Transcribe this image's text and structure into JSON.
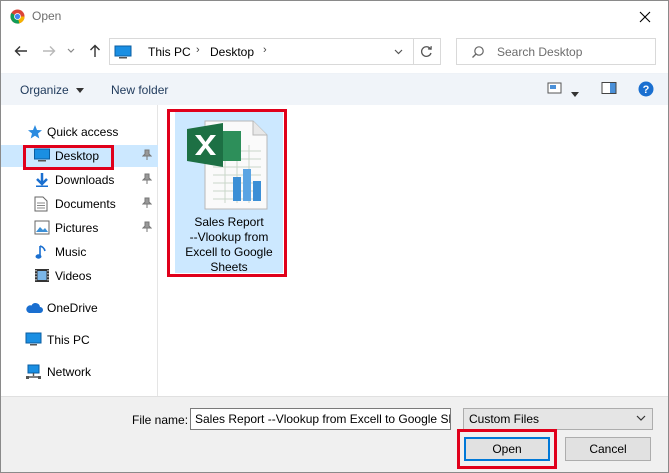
{
  "window": {
    "title": "Open"
  },
  "address": {
    "crumbs": [
      "This PC",
      "Desktop"
    ]
  },
  "search": {
    "placeholder": "Search Desktop"
  },
  "toolbar": {
    "organize_label": "Organize",
    "new_folder_label": "New folder"
  },
  "navpane": {
    "quick_access": "Quick access",
    "items": [
      {
        "label": "Desktop",
        "icon": "desktop-icon",
        "pinned": true,
        "selected": true
      },
      {
        "label": "Downloads",
        "icon": "downloads-icon",
        "pinned": true
      },
      {
        "label": "Documents",
        "icon": "documents-icon",
        "pinned": true
      },
      {
        "label": "Pictures",
        "icon": "pictures-icon",
        "pinned": true
      },
      {
        "label": "Music",
        "icon": "music-icon"
      },
      {
        "label": "Videos",
        "icon": "videos-icon"
      }
    ],
    "onedrive": "OneDrive",
    "this_pc": "This PC",
    "network": "Network"
  },
  "files": [
    {
      "name_lines": [
        "Sales Report",
        "--Vlookup from",
        "Excell to Google",
        "Sheets"
      ],
      "icon": "excel-file-icon",
      "selected": true
    }
  ],
  "bottom": {
    "file_name_label": "File name:",
    "file_name_value": "Sales Report --Vlookup from Excell to Google Sheets",
    "file_type": "Custom Files",
    "open_label": "Open",
    "cancel_label": "Cancel"
  },
  "colors": {
    "highlight": "#e0001b",
    "selection": "#cce8ff",
    "accent": "#0078d7"
  }
}
